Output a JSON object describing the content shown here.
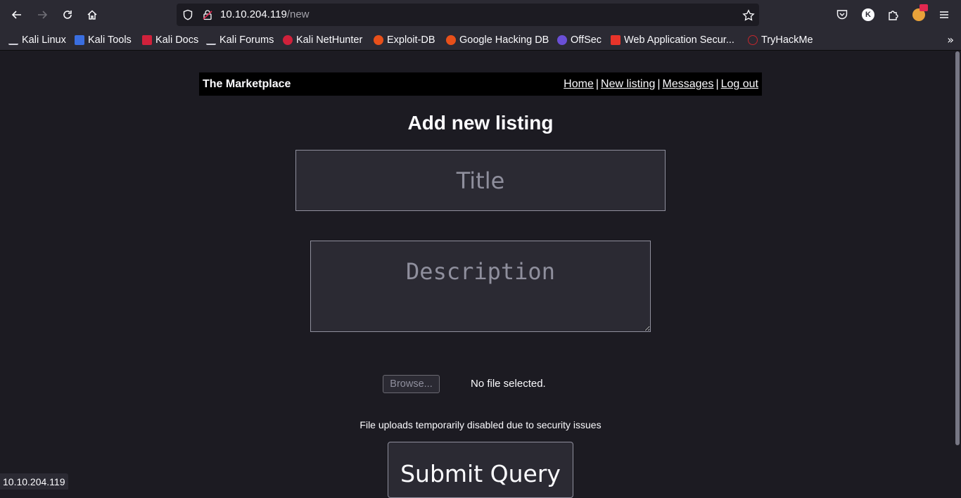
{
  "browser": {
    "url_host": "10.10.204.119",
    "url_path": "/new",
    "status_url": "10.10.204.119",
    "profile_initial": "K"
  },
  "bookmarks": [
    {
      "label": "Kali Linux",
      "icon": "kali-dragon-icon",
      "color": "#cfcfd8"
    },
    {
      "label": "Kali Tools",
      "icon": "kali-tools-icon",
      "color": "#3a6ee0"
    },
    {
      "label": "Kali Docs",
      "icon": "kali-docs-icon",
      "color": "#d0213b"
    },
    {
      "label": "Kali Forums",
      "icon": "kali-dragon-icon",
      "color": "#cfcfd8"
    },
    {
      "label": "Kali NetHunter",
      "icon": "nethunter-icon",
      "color": "#d0213b"
    },
    {
      "label": "Exploit-DB",
      "icon": "exploit-db-icon",
      "color": "#e8501a"
    },
    {
      "label": "Google Hacking DB",
      "icon": "ghdb-icon",
      "color": "#e8501a"
    },
    {
      "label": "OffSec",
      "icon": "offsec-icon",
      "color": "#6a4fd6"
    },
    {
      "label": "Web Application Secur...",
      "icon": "portswigger-icon",
      "color": "#e8342a"
    },
    {
      "label": "TryHackMe",
      "icon": "tryhackme-icon",
      "color": "#c2272d"
    }
  ],
  "site": {
    "brand": "The Marketplace",
    "nav": {
      "home": "Home",
      "new_listing": "New listing",
      "messages": "Messages",
      "logout": "Log out",
      "separator": "|"
    }
  },
  "form": {
    "heading": "Add new listing",
    "title_placeholder": "Title",
    "title_value": "",
    "description_placeholder": "Description",
    "description_value": "",
    "browse_label": "Browse...",
    "file_status": "No file selected.",
    "upload_note": "File uploads temporarily disabled due to security issues",
    "submit_label": "Submit Query"
  }
}
